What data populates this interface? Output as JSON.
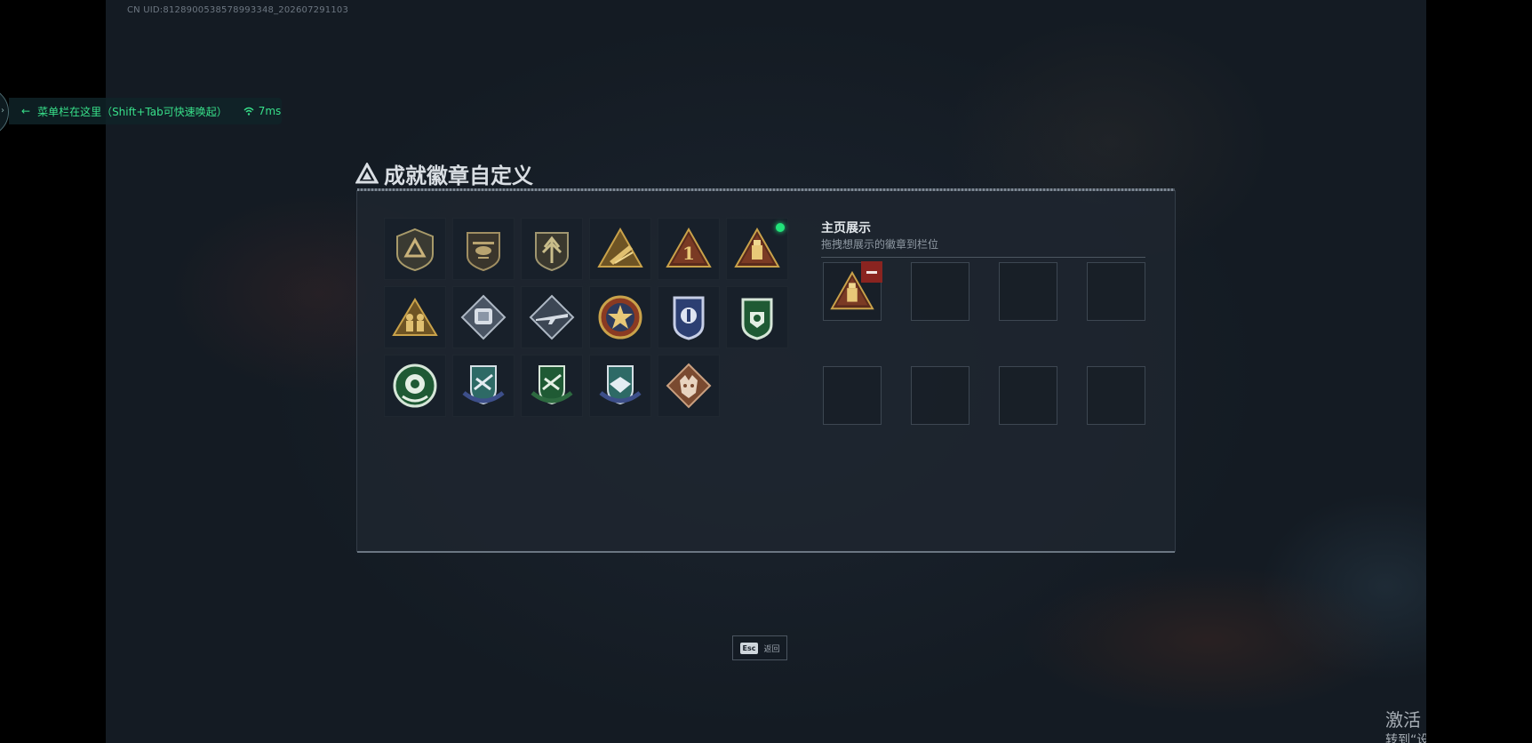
{
  "uid_text": "CN UID:8128900538578993348_202607291103",
  "window": {
    "title": "成就徽章自定义",
    "title_icon": "triangle-emblem-icon"
  },
  "badges": [
    {
      "icon": "shield-triangle-badge",
      "new": false
    },
    {
      "icon": "helicopter-shield-badge",
      "new": false
    },
    {
      "icon": "arrow-shield-badge",
      "new": false
    },
    {
      "icon": "gold-rocket-triangle-badge",
      "new": false
    },
    {
      "icon": "number-one-triangle-badge",
      "new": false
    },
    {
      "icon": "ammo-box-triangle-badge",
      "new": true
    },
    {
      "icon": "soldiers-triangle-badge",
      "new": false
    },
    {
      "icon": "armor-diamond-badge",
      "new": false
    },
    {
      "icon": "rifle-diamond-badge",
      "new": false
    },
    {
      "icon": "star-roundel-badge",
      "new": false
    },
    {
      "icon": "blue-police-shield-badge",
      "new": false
    },
    {
      "icon": "green-lion-shield-badge",
      "new": false
    },
    {
      "icon": "green-roundel-badge",
      "new": false
    },
    {
      "icon": "blue-wings-shield-badge",
      "new": false
    },
    {
      "icon": "green-wings-shield-badge",
      "new": false
    },
    {
      "icon": "blue-eagle-shield-badge",
      "new": false
    },
    {
      "icon": "bronze-wolf-diamond-badge",
      "new": false
    }
  ],
  "home_display": {
    "title": "主页展示",
    "subtitle": "拖拽想展示的徽章到栏位",
    "slots": [
      {
        "filled": true,
        "icon": "ammo-box-triangle-badge"
      },
      {
        "filled": false
      },
      {
        "filled": false
      },
      {
        "filled": false
      },
      {
        "filled": false
      },
      {
        "filled": false
      },
      {
        "filled": false
      },
      {
        "filled": false
      }
    ]
  },
  "footer": {
    "esc_key": "Esc",
    "esc_label": "返回"
  },
  "overlay": {
    "menu_hint": "菜单栏在这里（Shift+Tab可快速唤起）",
    "ping": "7ms"
  },
  "watermark": {
    "line1": "激活 Windows",
    "line2": "转到“设置”以激活 Windows。"
  },
  "colors": {
    "accent_green": "#38e08a",
    "new_dot": "#22e37a",
    "remove_red": "#8a2420",
    "gold": "#c9a24a"
  }
}
